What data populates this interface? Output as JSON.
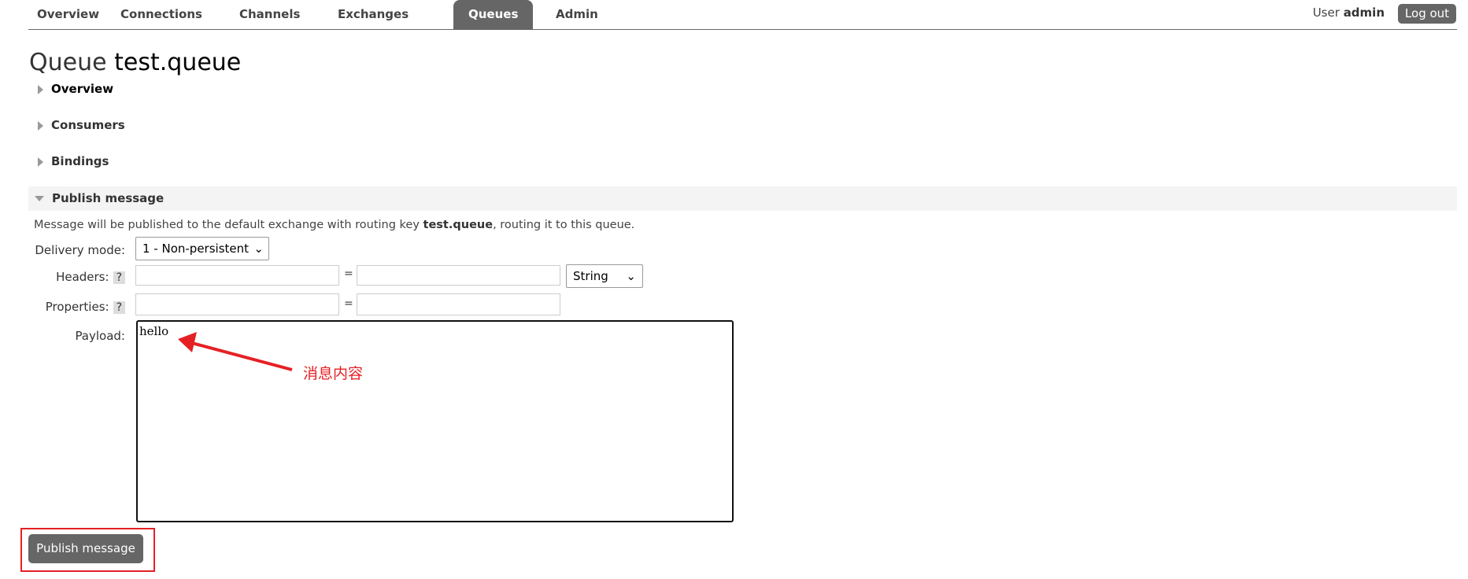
{
  "nav": {
    "tabs": [
      "Overview",
      "Connections",
      "Channels",
      "Exchanges",
      "Queues",
      "Admin"
    ],
    "active": "Queues"
  },
  "user": {
    "prefix": "User",
    "name": "admin",
    "logout": "Log out"
  },
  "title": {
    "kind": "Queue",
    "name": "test.queue"
  },
  "sections": [
    "Overview",
    "Consumers",
    "Bindings",
    "Publish message"
  ],
  "publish": {
    "desc_pre": "Message will be published to the default exchange with routing key ",
    "desc_key": "test.queue",
    "desc_post": ", routing it to this queue.",
    "delivery_label": "Delivery mode:",
    "delivery_value": "1 - Non-persistent",
    "headers_label": "Headers:",
    "properties_label": "Properties:",
    "help": "?",
    "eq": "=",
    "header_type": "String",
    "payload_label": "Payload:",
    "payload": "hello",
    "button": "Publish message"
  },
  "annotation": {
    "text": "消息内容",
    "color": "#e52025"
  }
}
